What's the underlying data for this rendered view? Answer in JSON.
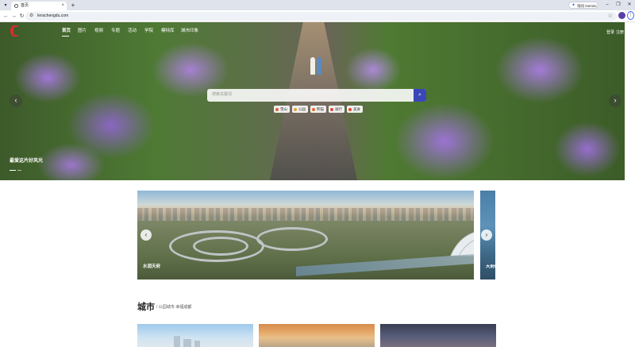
{
  "browser": {
    "tab_title": "首页",
    "tab_close": "×",
    "new_tab": "+",
    "gemini_label": "询问 Gemini",
    "url": "lenschengdu.com",
    "window_controls": [
      "–",
      "❐",
      "✕"
    ]
  },
  "site": {
    "nav": [
      "首页",
      "图片",
      "视频",
      "专题",
      "活动",
      "学院",
      "模特库",
      "城市印象"
    ],
    "nav_right": [
      "登录",
      "注册"
    ],
    "search_placeholder": "搜索关键词",
    "tags": [
      {
        "label": "雪山",
        "color": "#e85a3a"
      },
      {
        "label": "公园",
        "color": "#e8a23a"
      },
      {
        "label": "熊猫",
        "color": "#e06a2a"
      },
      {
        "label": "骑行",
        "color": "#d94a3a"
      },
      {
        "label": "美食",
        "color": "#e2452f"
      }
    ],
    "hero_caption": "最爱这片好风光",
    "carousel": {
      "main_caption": "水润天府",
      "side_caption": "天府新区"
    },
    "city_section": {
      "title": "城市",
      "subtitle": "/ 公园城市·幸福成都"
    }
  },
  "colors": {
    "brand_red": "#e02a2a",
    "search_button": "#3b47b8"
  },
  "icons": {
    "search": "search-icon",
    "left": "chevron-left-icon",
    "right": "chevron-right-icon"
  }
}
